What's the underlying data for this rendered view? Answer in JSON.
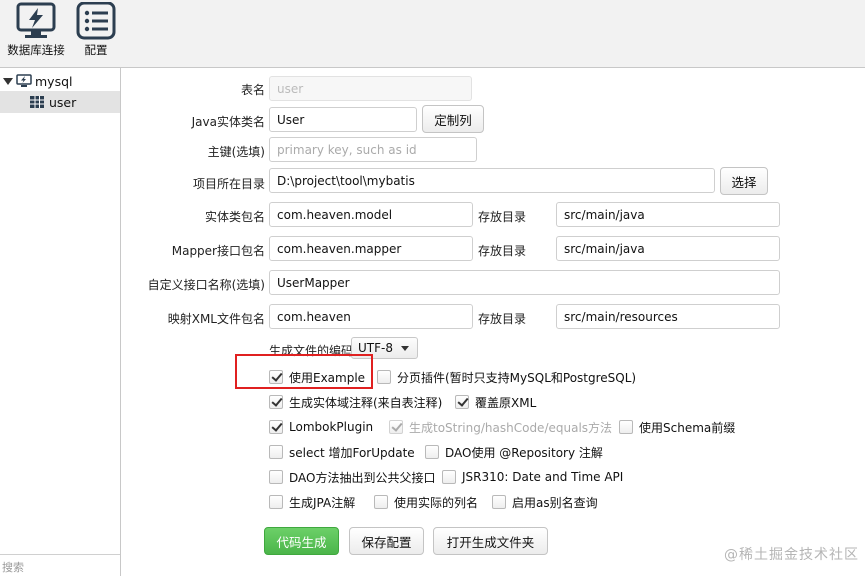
{
  "toolbar": {
    "db_connect_label": "数据库连接",
    "config_label": "配置"
  },
  "sidebar": {
    "tree": {
      "connection": "mysql",
      "table": "user"
    },
    "search_placeholder": "搜索"
  },
  "form": {
    "table_name": {
      "label": "表名",
      "value": "user"
    },
    "entity_name": {
      "label": "Java实体类名",
      "value": "User",
      "button": "定制列"
    },
    "primary_key": {
      "label": "主键(选填)",
      "placeholder": "primary key, such as id"
    },
    "project_dir": {
      "label": "项目所在目录",
      "value": "D:\\project\\tool\\mybatis",
      "button": "选择"
    },
    "entity_package": {
      "label": "实体类包名",
      "value": "com.heaven.model",
      "dir_label": "存放目录",
      "dir_value": "src/main/java"
    },
    "mapper_package": {
      "label": "Mapper接口包名",
      "value": "com.heaven.mapper",
      "dir_label": "存放目录",
      "dir_value": "src/main/java"
    },
    "custom_interface": {
      "label": "自定义接口名称(选填)",
      "value": "UserMapper"
    },
    "xml_package": {
      "label": "映射XML文件包名",
      "value": "com.heaven",
      "dir_label": "存放目录",
      "dir_value": "src/main/resources"
    },
    "encoding": {
      "label": "生成文件的编码",
      "value": "UTF-8"
    }
  },
  "options": {
    "use_example": {
      "label": "使用Example",
      "checked": true
    },
    "pagination": {
      "label": "分页插件(暂时只支持MySQL和PostgreSQL)",
      "checked": false
    },
    "entity_comment": {
      "label": "生成实体域注释(来自表注释)",
      "checked": true
    },
    "overwrite_xml": {
      "label": "覆盖原XML",
      "checked": true
    },
    "lombok": {
      "label": "LombokPlugin",
      "checked": true
    },
    "tostring": {
      "label": "生成toString/hashCode/equals方法",
      "checked": true
    },
    "schema_prefix": {
      "label": "使用Schema前缀",
      "checked": false
    },
    "select_for_update": {
      "label": "select 增加ForUpdate",
      "checked": false
    },
    "dao_repository": {
      "label": "DAO使用 @Repository 注解",
      "checked": false
    },
    "dao_parent": {
      "label": "DAO方法抽出到公共父接口",
      "checked": false
    },
    "jsr310": {
      "label": "JSR310: Date and Time API",
      "checked": false
    },
    "jpa": {
      "label": "生成JPA注解",
      "checked": false
    },
    "actual_column": {
      "label": "使用实际的列名",
      "checked": false
    },
    "alias_query": {
      "label": "启用as别名查询",
      "checked": false
    }
  },
  "actions": {
    "generate": "代码生成",
    "save_config": "保存配置",
    "open_folder": "打开生成文件夹"
  },
  "watermark": "@稀土掘金技术社区",
  "colors": {
    "primary_button": "#4bb54a",
    "highlight_border": "#e02020"
  }
}
